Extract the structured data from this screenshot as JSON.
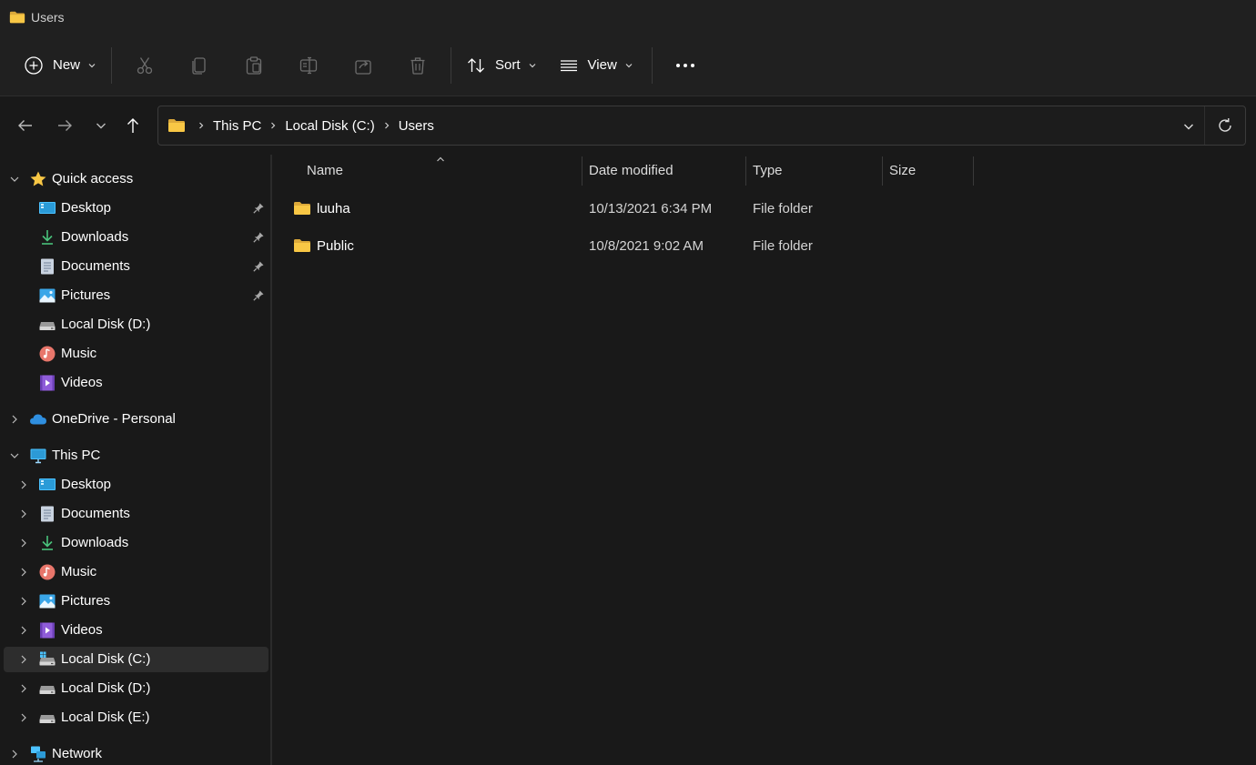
{
  "window": {
    "title": "Users"
  },
  "toolbar": {
    "new_label": "New",
    "sort_label": "Sort",
    "view_label": "View"
  },
  "address": {
    "crumbs": [
      "This PC",
      "Local Disk (C:)",
      "Users"
    ]
  },
  "sidebar": {
    "quick_access": {
      "label": "Quick access",
      "items": [
        {
          "label": "Desktop",
          "icon": "desktop-icon",
          "pinned": true
        },
        {
          "label": "Downloads",
          "icon": "download-icon",
          "pinned": true
        },
        {
          "label": "Documents",
          "icon": "document-icon",
          "pinned": true
        },
        {
          "label": "Pictures",
          "icon": "pictures-icon",
          "pinned": true
        },
        {
          "label": "Local Disk (D:)",
          "icon": "drive-icon",
          "pinned": false
        },
        {
          "label": "Music",
          "icon": "music-icon",
          "pinned": false
        },
        {
          "label": "Videos",
          "icon": "videos-icon",
          "pinned": false
        }
      ]
    },
    "onedrive": {
      "label": "OneDrive - Personal"
    },
    "this_pc": {
      "label": "This PC",
      "items": [
        {
          "label": "Desktop",
          "icon": "desktop-icon"
        },
        {
          "label": "Documents",
          "icon": "document-icon"
        },
        {
          "label": "Downloads",
          "icon": "download-icon"
        },
        {
          "label": "Music",
          "icon": "music-icon"
        },
        {
          "label": "Pictures",
          "icon": "pictures-icon"
        },
        {
          "label": "Videos",
          "icon": "videos-icon"
        },
        {
          "label": "Local Disk (C:)",
          "icon": "system-drive-icon",
          "selected": true
        },
        {
          "label": "Local Disk (D:)",
          "icon": "drive-icon"
        },
        {
          "label": "Local Disk (E:)",
          "icon": "drive-icon"
        }
      ]
    },
    "network": {
      "label": "Network"
    }
  },
  "columns": {
    "name": "Name",
    "date_modified": "Date modified",
    "type": "Type",
    "size": "Size"
  },
  "files": [
    {
      "name": "luuha",
      "date_modified": "10/13/2021 6:34 PM",
      "type": "File folder",
      "size": ""
    },
    {
      "name": "Public",
      "date_modified": "10/8/2021 9:02 AM",
      "type": "File folder",
      "size": ""
    }
  ],
  "colors": {
    "background": "#191919",
    "chrome": "#202020",
    "folder_yellow": "#f8c745",
    "accent": "#4cc2ff"
  }
}
